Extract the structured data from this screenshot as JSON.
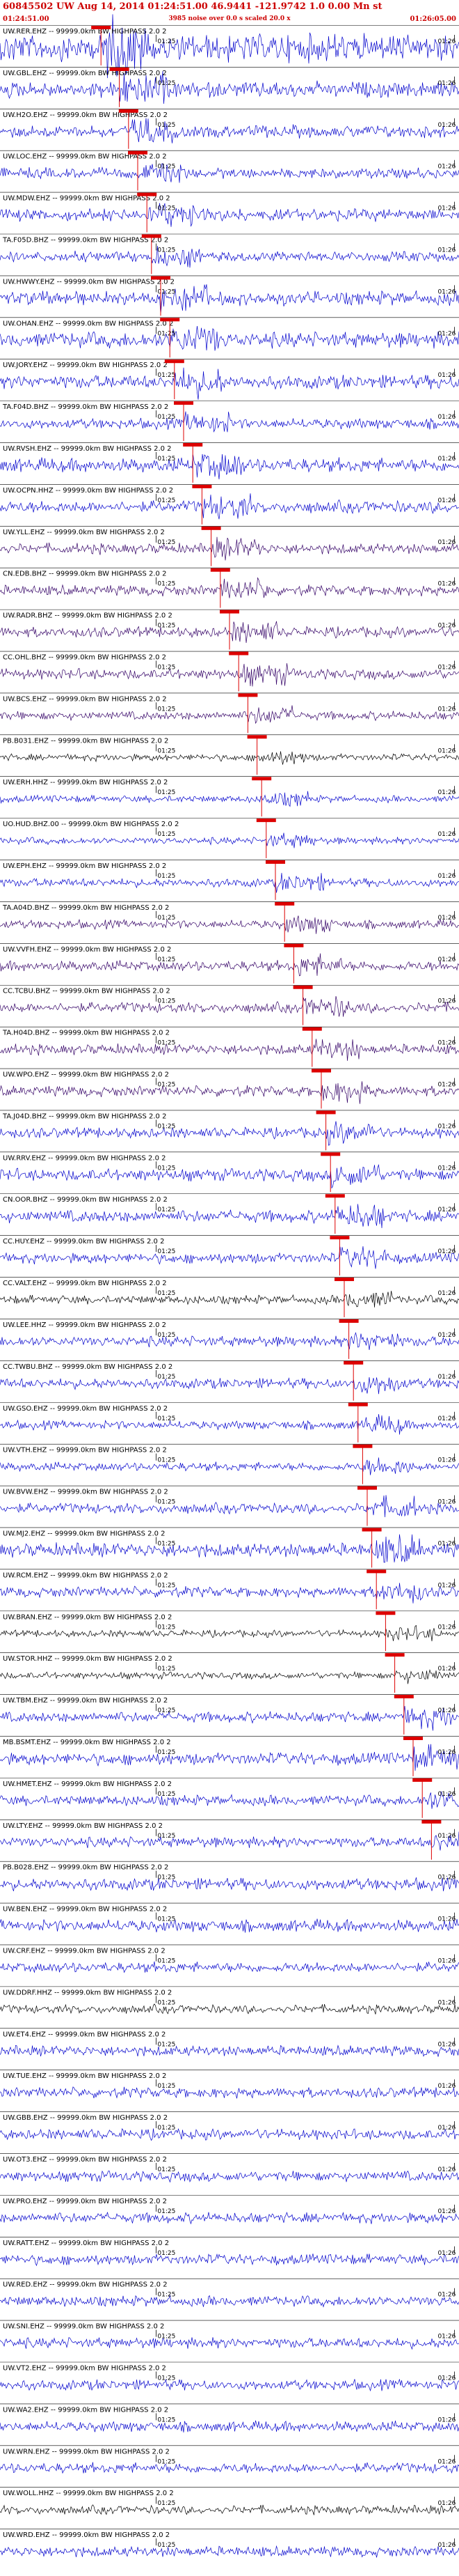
{
  "header": {
    "title": "60845502 UW Aug 14, 2014 01:24:51.00   46.9441  -121.9742  1.0 0.00 Mn st",
    "start_time": "01:24:51.00",
    "end_time": "01:26:05.00",
    "note": "3985 noise over 0.0 s scaled 20.0 x"
  },
  "chart_data": {
    "type": "line",
    "title": "60845502 UW Aug 14, 2014 01:24:51.00   46.9441  -121.9742  1.0 0.00 Mn st",
    "xlabel": "",
    "ylabel": "",
    "x_range": [
      "01:24:51.00",
      "01:26:05.00"
    ],
    "tick_labels": [
      "01:25",
      "01:26"
    ],
    "grid": false,
    "legend": "none",
    "colors": {
      "blue": "#0000cc",
      "black": "#000000",
      "purple": "#330066",
      "red": "#dd0000"
    },
    "series": [
      {
        "name": "UW.RER.EHZ -- 99999.0km BW  HIGHPASS  2.0  2",
        "color": "blue",
        "amp": 0.8,
        "pick": 0.22
      },
      {
        "name": "UW.GBL.EHZ -- 99999.0km BW  HIGHPASS  2.0  2",
        "color": "blue",
        "amp": 0.45,
        "pick": 0.26
      },
      {
        "name": "UW.H2O.EHZ -- 99999.0km BW  HIGHPASS  2.0  2",
        "color": "blue",
        "amp": 0.35,
        "pick": 0.28
      },
      {
        "name": "UW.LOC.EHZ -- 99999.0km BW  HIGHPASS  2.0  2",
        "color": "blue",
        "amp": 0.3,
        "pick": 0.3
      },
      {
        "name": "UW.MDW.EHZ -- 99999.0km BW  HIGHPASS  2.0  2",
        "color": "blue",
        "amp": 0.35,
        "pick": 0.32
      },
      {
        "name": "TA.F05D.BHZ -- 99999.0km BW  HIGHPASS  2.0  2",
        "color": "blue",
        "amp": 0.3,
        "pick": 0.33
      },
      {
        "name": "UW.HWWY.EHZ -- 99999.0km BW  HIGHPASS  2.0  2",
        "color": "blue",
        "amp": 0.4,
        "pick": 0.35
      },
      {
        "name": "UW.OHAN.EHZ -- 99999.0km BW  HIGHPASS  2.0  2",
        "color": "blue",
        "amp": 0.45,
        "pick": 0.37
      },
      {
        "name": "UW.JORY.EHZ -- 99999.0km BW  HIGHPASS  2.0  2",
        "color": "blue",
        "amp": 0.4,
        "pick": 0.38
      },
      {
        "name": "TA.F04D.BHZ -- 99999.0km BW  HIGHPASS  2.0  2",
        "color": "blue",
        "amp": 0.3,
        "pick": 0.4
      },
      {
        "name": "UW.RVSH.EHZ -- 99999.0km BW  HIGHPASS  2.0  2",
        "color": "blue",
        "amp": 0.4,
        "pick": 0.42
      },
      {
        "name": "UW.OCPN.HHZ -- 99999.0km BW  HIGHPASS  2.0  2",
        "color": "blue",
        "amp": 0.35,
        "pick": 0.44
      },
      {
        "name": "UW.YLL.EHZ -- 99999.0km BW  HIGHPASS  2.0  2",
        "color": "purple",
        "amp": 0.3,
        "pick": 0.46
      },
      {
        "name": "CN.EDB.BHZ -- 99999.0km BW  HIGHPASS  2.0  2",
        "color": "purple",
        "amp": 0.3,
        "pick": 0.48
      },
      {
        "name": "UW.RADR.BHZ -- 99999.0km BW  HIGHPASS  2.0  2",
        "color": "purple",
        "amp": 0.3,
        "pick": 0.5
      },
      {
        "name": "CC.OHL.BHZ -- 99999.0km BW  HIGHPASS  2.0  2",
        "color": "purple",
        "amp": 0.3,
        "pick": 0.52
      },
      {
        "name": "UW.BCS.EHZ -- 99999.0km BW  HIGHPASS  2.0  2",
        "color": "purple",
        "amp": 0.25,
        "pick": 0.54
      },
      {
        "name": "PB.B031.EHZ -- 99999.0km BW  HIGHPASS  2.0  2",
        "color": "black",
        "amp": 0.2,
        "pick": 0.56
      },
      {
        "name": "UW.ERH.HHZ -- 99999.0km BW  HIGHPASS  2.0  2",
        "color": "blue",
        "amp": 0.2,
        "pick": 0.57
      },
      {
        "name": "UO.HUD.BHZ.00 -- 99999.0km BW  HIGHPASS  2.0  2",
        "color": "blue",
        "amp": 0.2,
        "pick": 0.58
      },
      {
        "name": "UW.EPH.EHZ -- 99999.0km BW  HIGHPASS  2.0  2",
        "color": "blue",
        "amp": 0.25,
        "pick": 0.6
      },
      {
        "name": "TA.A04D.BHZ -- 99999.0km BW  HIGHPASS  2.0  2",
        "color": "purple",
        "amp": 0.25,
        "pick": 0.62
      },
      {
        "name": "UW.VVFH.EHZ -- 99999.0km BW  HIGHPASS  2.0  2",
        "color": "purple",
        "amp": 0.3,
        "pick": 0.64
      },
      {
        "name": "CC.TCBU.BHZ -- 99999.0km BW  HIGHPASS  2.0  2",
        "color": "purple",
        "amp": 0.3,
        "pick": 0.66
      },
      {
        "name": "TA.H04D.BHZ -- 99999.0km BW  HIGHPASS  2.0  2",
        "color": "purple",
        "amp": 0.3,
        "pick": 0.68
      },
      {
        "name": "UW.WPO.EHZ -- 99999.0km BW  HIGHPASS  2.0  2",
        "color": "purple",
        "amp": 0.3,
        "pick": 0.7
      },
      {
        "name": "TA.J04D.BHZ -- 99999.0km BW  HIGHPASS  2.0  2",
        "color": "blue",
        "amp": 0.3,
        "pick": 0.71
      },
      {
        "name": "UW.RRV.EHZ -- 99999.0km BW  HIGHPASS  2.0  2",
        "color": "blue",
        "amp": 0.35,
        "pick": 0.72
      },
      {
        "name": "CN.OOR.BHZ -- 99999.0km BW  HIGHPASS  2.0  2",
        "color": "blue",
        "amp": 0.35,
        "pick": 0.73
      },
      {
        "name": "CC.HUY.EHZ -- 99999.0km BW  HIGHPASS  2.0  2",
        "color": "blue",
        "amp": 0.3,
        "pick": 0.74
      },
      {
        "name": "CC.VALT.EHZ -- 99999.0km BW  HIGHPASS  2.0  2",
        "color": "black",
        "amp": 0.25,
        "pick": 0.75
      },
      {
        "name": "UW.LEE.HHZ -- 99999.0km BW  HIGHPASS  2.0  2",
        "color": "blue",
        "amp": 0.3,
        "pick": 0.76
      },
      {
        "name": "CC.TWBU.BHZ -- 99999.0km BW  HIGHPASS  2.0  2",
        "color": "blue",
        "amp": 0.3,
        "pick": 0.77
      },
      {
        "name": "UW.GSO.EHZ -- 99999.0km BW  HIGHPASS  2.0  2",
        "color": "blue",
        "amp": 0.25,
        "pick": 0.78
      },
      {
        "name": "UW.VTH.EHZ -- 99999.0km BW  HIGHPASS  2.0  2",
        "color": "blue",
        "amp": 0.25,
        "pick": 0.79
      },
      {
        "name": "UW.BVW.EHZ -- 99999.0km BW  HIGHPASS  2.0  2",
        "color": "blue",
        "amp": 0.3,
        "pick": 0.8
      },
      {
        "name": "UW.MJ2.EHZ -- 99999.0km BW  HIGHPASS  2.0  2",
        "color": "blue",
        "amp": 0.4,
        "pick": 0.81
      },
      {
        "name": "UW.RCM.EHZ -- 99999.0km BW  HIGHPASS  2.0  2",
        "color": "blue",
        "amp": 0.3,
        "pick": 0.82
      },
      {
        "name": "UW.BRAN.EHZ -- 99999.0km BW  HIGHPASS  2.0  2",
        "color": "black",
        "amp": 0.2,
        "pick": 0.84
      },
      {
        "name": "UW.STOR.HHZ -- 99999.0km BW  HIGHPASS  2.0  2",
        "color": "black",
        "amp": 0.2,
        "pick": 0.86
      },
      {
        "name": "UW.TBM.EHZ -- 99999.0km BW  HIGHPASS  2.0  2",
        "color": "blue",
        "amp": 0.3,
        "pick": 0.88
      },
      {
        "name": "MB.BSMT.EHZ -- 99999.0km BW  HIGHPASS  2.0  2",
        "color": "blue",
        "amp": 0.35,
        "pick": 0.9
      },
      {
        "name": "UW.HMET.EHZ -- 99999.0km BW  HIGHPASS  2.0  2",
        "color": "blue",
        "amp": 0.3,
        "pick": 0.92
      },
      {
        "name": "UW.LTY.EHZ -- 99999.0km BW  HIGHPASS  2.0  2",
        "color": "blue",
        "amp": 0.3,
        "pick": 0.94
      },
      {
        "name": "PB.B028.EHZ -- 99999.0km BW  HIGHPASS  2.0  2",
        "color": "blue",
        "amp": 0.35,
        "pick": null
      },
      {
        "name": "UW.BEN.EHZ -- 99999.0km BW  HIGHPASS  2.0  2",
        "color": "blue",
        "amp": 0.35,
        "pick": null
      },
      {
        "name": "UW.CRF.EHZ -- 99999.0km BW  HIGHPASS  2.0  2",
        "color": "blue",
        "amp": 0.3,
        "pick": null
      },
      {
        "name": "UW.DDRF.HHZ -- 99999.0km BW  HIGHPASS  2.0  2",
        "color": "black",
        "amp": 0.25,
        "pick": null
      },
      {
        "name": "UW.ET4.EHZ -- 99999.0km BW  HIGHPASS  2.0  2",
        "color": "blue",
        "amp": 0.3,
        "pick": null
      },
      {
        "name": "UW.TUE.EHZ -- 99999.0km BW  HIGHPASS  2.0  2",
        "color": "blue",
        "amp": 0.3,
        "pick": null
      },
      {
        "name": "UW.GBB.EHZ -- 99999.0km BW  HIGHPASS  2.0  2",
        "color": "blue",
        "amp": 0.3,
        "pick": null
      },
      {
        "name": "UW.OT3.EHZ -- 99999.0km BW  HIGHPASS  2.0  2",
        "color": "blue",
        "amp": 0.3,
        "pick": null
      },
      {
        "name": "UW.PRO.EHZ -- 99999.0km BW  HIGHPASS  2.0  2",
        "color": "blue",
        "amp": 0.3,
        "pick": null
      },
      {
        "name": "UW.RATT.EHZ -- 99999.0km BW  HIGHPASS  2.0  2",
        "color": "blue",
        "amp": 0.3,
        "pick": null
      },
      {
        "name": "UW.RED.EHZ -- 99999.0km BW  HIGHPASS  2.0  2",
        "color": "blue",
        "amp": 0.3,
        "pick": null
      },
      {
        "name": "UW.SNI.EHZ -- 99999.0km BW  HIGHPASS  2.0  2",
        "color": "blue",
        "amp": 0.3,
        "pick": null
      },
      {
        "name": "UW.VT2.EHZ -- 99999.0km BW  HIGHPASS  2.0  2",
        "color": "blue",
        "amp": 0.3,
        "pick": null
      },
      {
        "name": "UW.WA2.EHZ -- 99999.0km BW  HIGHPASS  2.0  2",
        "color": "blue",
        "amp": 0.3,
        "pick": null
      },
      {
        "name": "UW.WRN.EHZ -- 99999.0km BW  HIGHPASS  2.0  2",
        "color": "blue",
        "amp": 0.3,
        "pick": null
      },
      {
        "name": "UW.WOLL.HHZ -- 99999.0km BW  HIGHPASS  2.0  2",
        "color": "black",
        "amp": 0.25,
        "pick": null
      },
      {
        "name": "UW.WRD.EHZ -- 99999.0km BW  HIGHPASS  2.0  2",
        "color": "blue",
        "amp": 0.3,
        "pick": null
      }
    ]
  }
}
